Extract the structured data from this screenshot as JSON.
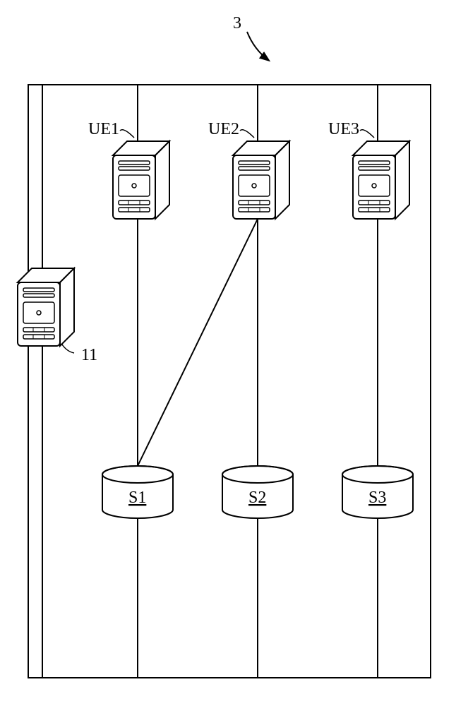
{
  "diagram": {
    "figure_label": "3",
    "servers": [
      {
        "id": "ue1",
        "label": "UE1"
      },
      {
        "id": "ue2",
        "label": "UE2"
      },
      {
        "id": "ue3",
        "label": "UE3"
      },
      {
        "id": "ctrl",
        "label": "11"
      }
    ],
    "storages": [
      {
        "id": "s1",
        "label": "S1"
      },
      {
        "id": "s2",
        "label": "S2"
      },
      {
        "id": "s3",
        "label": "S3"
      }
    ]
  }
}
